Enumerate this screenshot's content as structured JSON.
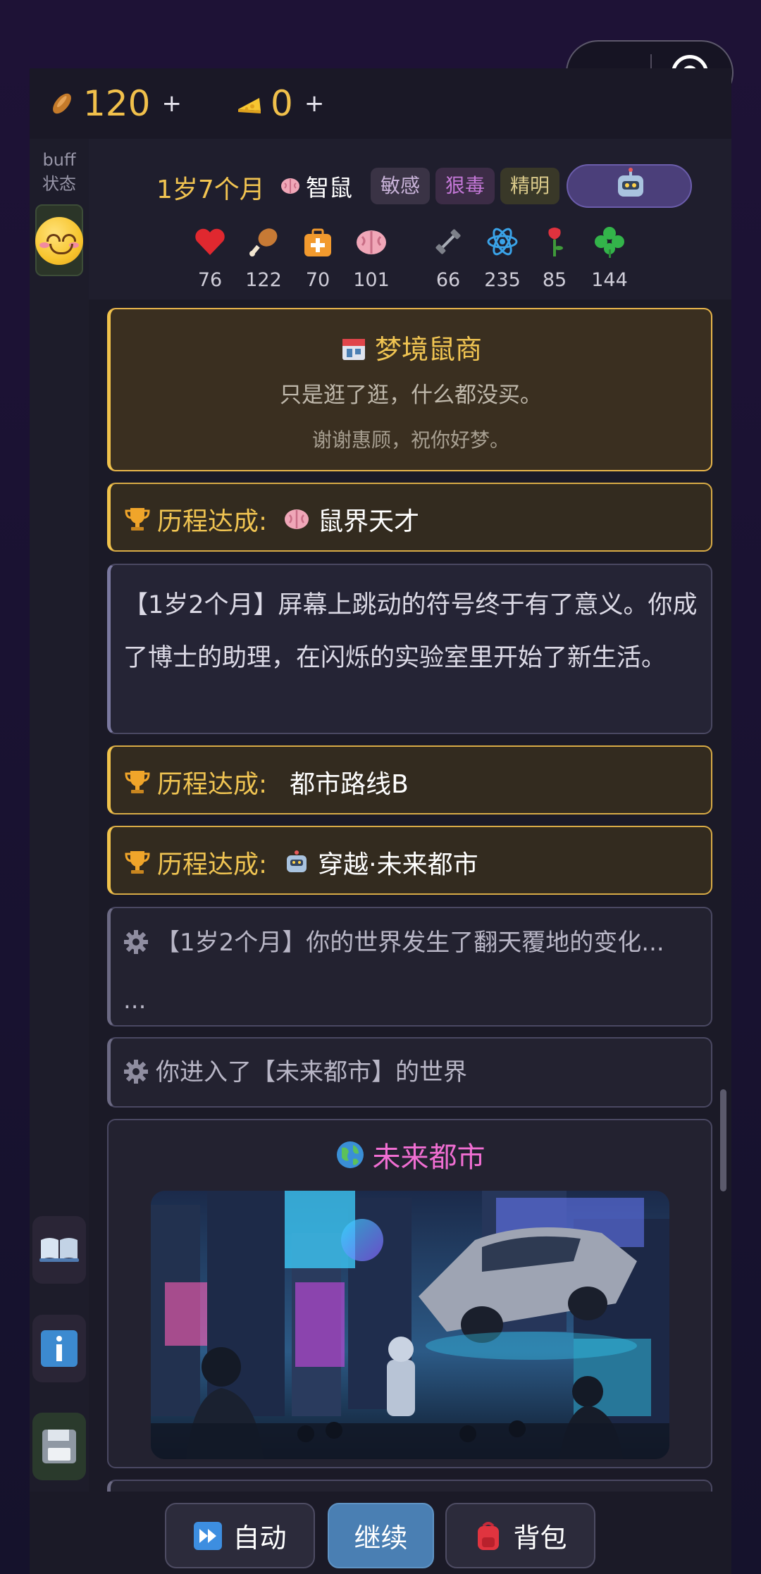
{
  "currency": {
    "seeds": {
      "icon": "seed-icon",
      "value": "120",
      "plus": "+"
    },
    "cheese": {
      "icon": "cheese-icon",
      "value": "0",
      "plus": "+"
    }
  },
  "sidebar": {
    "buff_label": "buff\n状态",
    "buff_icon": "smiling-face-icon",
    "buttons": [
      "book-icon",
      "info-icon",
      "save-disk-icon"
    ]
  },
  "header": {
    "age": "1岁7个月",
    "rank": {
      "icon": "brain-icon",
      "label": "智鼠"
    },
    "tags": [
      {
        "label": "敏感",
        "color": "#c9b3d9"
      },
      {
        "label": "狠毒",
        "color": "#c377d6"
      },
      {
        "label": "精明",
        "color": "#d9c98a"
      }
    ],
    "avatar_icon": "robot-icon",
    "stats": [
      {
        "icon": "heart-icon",
        "value": "76"
      },
      {
        "icon": "drumstick-icon",
        "value": "122"
      },
      {
        "icon": "medkit-icon",
        "value": "70"
      },
      {
        "icon": "brain-icon",
        "value": "101"
      },
      {
        "icon": "dumbbell-icon",
        "value": "66"
      },
      {
        "icon": "atom-icon",
        "value": "235"
      },
      {
        "icon": "rose-icon",
        "value": "85"
      },
      {
        "icon": "clover-icon",
        "value": "144"
      }
    ]
  },
  "feed": {
    "shop": {
      "icon": "convenience-store-icon",
      "title": "梦境鼠商",
      "line1": "只是逛了逛，什么都没买。",
      "line2": "谢谢惠顾，祝你好梦。"
    },
    "achievement1": {
      "icon": "trophy-icon",
      "label": "历程达成:",
      "name_icon": "brain-icon",
      "name": "鼠界天才"
    },
    "story": "【1岁2个月】屏幕上跳动的符号终于有了意义。你成了博士的助理，在闪烁的实验室里开始了新生活。",
    "achievement2": {
      "icon": "trophy-icon",
      "label": "历程达成:",
      "name": "都市路线B"
    },
    "achievement3": {
      "icon": "trophy-icon",
      "label": "历程达成:",
      "name_icon": "robot-icon",
      "name": "穿越·未来都市"
    },
    "system1": {
      "icon": "gear-icon",
      "text": "【1岁2个月】你的世界发生了翻天覆地的变化...",
      "text2": "..."
    },
    "system2": {
      "icon": "gear-icon",
      "text": "你进入了【未来都市】的世界"
    },
    "world": {
      "icon": "globe-icon",
      "title": "未来都市",
      "image": "future-city-illustration"
    }
  },
  "bottom": {
    "auto": {
      "icon": "fast-forward-icon",
      "label": "自动"
    },
    "continue": {
      "label": "继续"
    },
    "bag": {
      "icon": "backpack-icon",
      "label": "背包"
    }
  },
  "colors": {
    "gold": "#f0c452",
    "accent_blue": "#4a7fb3",
    "magenta": "#f06ed2"
  }
}
